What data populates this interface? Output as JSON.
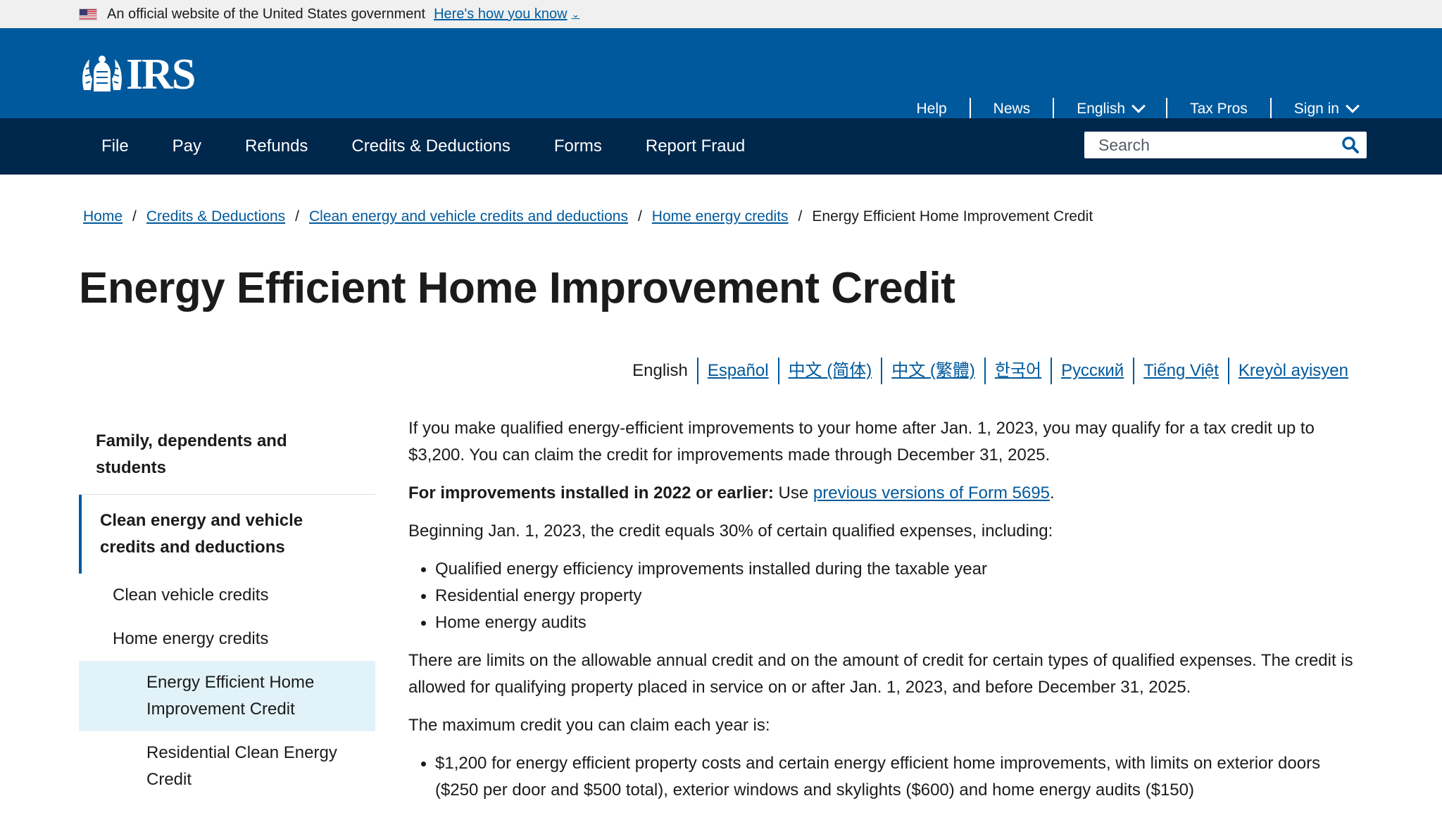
{
  "gov_banner": {
    "text": "An official website of the United States government",
    "link": "Here's how you know"
  },
  "header": {
    "logo_text": "IRS",
    "util_nav": [
      "Help",
      "News",
      "English",
      "Tax Pros",
      "Sign in"
    ]
  },
  "main_nav": {
    "items": [
      "File",
      "Pay",
      "Refunds",
      "Credits & Deductions",
      "Forms",
      "Report Fraud"
    ],
    "search_placeholder": "Search"
  },
  "breadcrumb": {
    "items": [
      "Home",
      "Credits & Deductions",
      "Clean energy and vehicle credits and deductions",
      "Home energy credits"
    ],
    "separator": "/",
    "current": "Energy Efficient Home Improvement Credit"
  },
  "page": {
    "title": "Energy Efficient Home Improvement Credit"
  },
  "languages": {
    "current": "English",
    "others": [
      "Español",
      "中文 (简体)",
      "中文 (繁體)",
      "한국어",
      "Русский",
      "Tiếng Việt",
      "Kreyòl ayisyen"
    ]
  },
  "sidebar": {
    "section1": "Family, dependents and students",
    "section2": "Clean energy and vehicle credits and deductions",
    "sub1": "Clean vehicle credits",
    "sub2": "Home energy credits",
    "subsub1": "Energy Efficient Home Improvement Credit",
    "subsub2": "Residential Clean Energy Credit"
  },
  "content": {
    "p1": "If you make qualified energy-efficient improvements to your home after Jan. 1, 2023, you may qualify for a tax credit up to $3,200. You can claim the credit for improvements made through December 31, 2025.",
    "p2_bold": "For improvements installed in 2022 or earlier:",
    "p2_text": " Use ",
    "p2_link": "previous versions of Form 5695",
    "p2_end": ".",
    "p3": "Beginning Jan. 1, 2023, the credit equals 30% of certain qualified expenses, including:",
    "list1": [
      "Qualified energy efficiency improvements installed during the taxable year",
      "Residential energy property",
      "Home energy audits"
    ],
    "p4": "There are limits on the allowable annual credit and on the amount of credit for certain types of qualified expenses. The credit is allowed for qualifying property placed in service on or after Jan. 1, 2023, and before December 31, 2025.",
    "p5": "The maximum credit you can claim each year is:",
    "list2": [
      "$1,200 for energy efficient property costs and certain energy efficient home improvements, with limits on exterior doors ($250 per door and $500 total), exterior windows and skylights ($600) and home energy audits ($150)"
    ]
  }
}
